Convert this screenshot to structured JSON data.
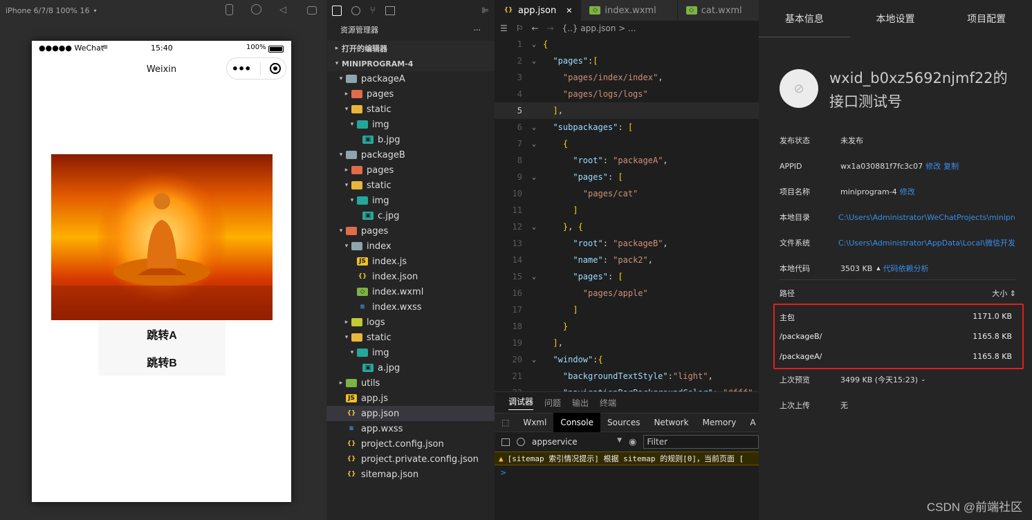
{
  "simulator": {
    "device_label": "iPhone 6/7/8 100% 16",
    "status_carrier": "●●●●● WeChat",
    "status_time": "15:40",
    "status_battery": "100%",
    "nav_title": "Weixin",
    "button_a": "跳转A",
    "button_b": "跳转B"
  },
  "explorer": {
    "title": "资源管理器",
    "more": "···",
    "open_editors": "打开的编辑器",
    "project": "MINIPROGRAM-4",
    "tree": [
      {
        "label": "packageA",
        "depth": 1,
        "arrow": "▾",
        "icon": "folder"
      },
      {
        "label": "pages",
        "depth": 2,
        "arrow": "▸",
        "icon": "pages-folder"
      },
      {
        "label": "static",
        "depth": 2,
        "arrow": "▾",
        "icon": "static-folder"
      },
      {
        "label": "img",
        "depth": 3,
        "arrow": "▾",
        "icon": "img-folder"
      },
      {
        "label": "b.jpg",
        "depth": 4,
        "arrow": "",
        "icon": "image-file"
      },
      {
        "label": "packageB",
        "depth": 1,
        "arrow": "▾",
        "icon": "folder"
      },
      {
        "label": "pages",
        "depth": 2,
        "arrow": "▸",
        "icon": "pages-folder"
      },
      {
        "label": "static",
        "depth": 2,
        "arrow": "▾",
        "icon": "static-folder"
      },
      {
        "label": "img",
        "depth": 3,
        "arrow": "▾",
        "icon": "img-folder"
      },
      {
        "label": "c.jpg",
        "depth": 4,
        "arrow": "",
        "icon": "image-file"
      },
      {
        "label": "pages",
        "depth": 1,
        "arrow": "▾",
        "icon": "pages-folder"
      },
      {
        "label": "index",
        "depth": 2,
        "arrow": "▾",
        "icon": "folder"
      },
      {
        "label": "index.js",
        "depth": 3,
        "arrow": "",
        "icon": "js-file"
      },
      {
        "label": "index.json",
        "depth": 3,
        "arrow": "",
        "icon": "json-file"
      },
      {
        "label": "index.wxml",
        "depth": 3,
        "arrow": "",
        "icon": "wxml-file"
      },
      {
        "label": "index.wxss",
        "depth": 3,
        "arrow": "",
        "icon": "wxss-file"
      },
      {
        "label": "logs",
        "depth": 2,
        "arrow": "▸",
        "icon": "logs-folder"
      },
      {
        "label": "static",
        "depth": 2,
        "arrow": "▾",
        "icon": "static-folder"
      },
      {
        "label": "img",
        "depth": 3,
        "arrow": "▾",
        "icon": "img-folder"
      },
      {
        "label": "a.jpg",
        "depth": 4,
        "arrow": "",
        "icon": "image-file"
      },
      {
        "label": "utils",
        "depth": 1,
        "arrow": "▸",
        "icon": "utils-folder"
      },
      {
        "label": "app.js",
        "depth": 1,
        "arrow": "",
        "icon": "js-file"
      },
      {
        "label": "app.json",
        "depth": 1,
        "arrow": "",
        "icon": "json-file",
        "selected": true
      },
      {
        "label": "app.wxss",
        "depth": 1,
        "arrow": "",
        "icon": "wxss-file"
      },
      {
        "label": "project.config.json",
        "depth": 1,
        "arrow": "",
        "icon": "json-file"
      },
      {
        "label": "project.private.config.json",
        "depth": 1,
        "arrow": "",
        "icon": "json-file"
      },
      {
        "label": "sitemap.json",
        "depth": 1,
        "arrow": "",
        "icon": "json-file"
      }
    ]
  },
  "editor": {
    "tabs": [
      {
        "label": "app.json",
        "icon": "json-file",
        "active": true,
        "close": "✕"
      },
      {
        "label": "index.wxml",
        "icon": "wxml-file"
      },
      {
        "label": "cat.wxml",
        "icon": "wxml-file"
      }
    ],
    "breadcrumb": "{..} app.json > ...",
    "current_line": 5,
    "lines": [
      {
        "n": 1,
        "fold": "v",
        "t": [
          [
            "p",
            "{"
          ]
        ]
      },
      {
        "n": 2,
        "fold": "v",
        "t": [
          [
            "w",
            "  "
          ],
          [
            "k",
            "\"pages\""
          ],
          [
            "w",
            ":"
          ],
          [
            "p",
            "["
          ]
        ]
      },
      {
        "n": 3,
        "fold": "",
        "t": [
          [
            "w",
            "    "
          ],
          [
            "s",
            "\"pages/index/index\""
          ],
          [
            "w",
            ","
          ]
        ]
      },
      {
        "n": 4,
        "fold": "",
        "t": [
          [
            "w",
            "    "
          ],
          [
            "s",
            "\"pages/logs/logs\""
          ]
        ]
      },
      {
        "n": 5,
        "fold": "",
        "t": [
          [
            "w",
            "  "
          ],
          [
            "p",
            "]"
          ],
          [
            "w",
            ","
          ]
        ]
      },
      {
        "n": 6,
        "fold": "v",
        "t": [
          [
            "w",
            "  "
          ],
          [
            "k",
            "\"subpackages\""
          ],
          [
            "w",
            ": "
          ],
          [
            "p",
            "["
          ]
        ]
      },
      {
        "n": 7,
        "fold": "v",
        "t": [
          [
            "w",
            "    "
          ],
          [
            "p",
            "{"
          ]
        ]
      },
      {
        "n": 8,
        "fold": "",
        "t": [
          [
            "w",
            "      "
          ],
          [
            "k",
            "\"root\""
          ],
          [
            "w",
            ": "
          ],
          [
            "s",
            "\"packageA\""
          ],
          [
            "w",
            ","
          ]
        ]
      },
      {
        "n": 9,
        "fold": "v",
        "t": [
          [
            "w",
            "      "
          ],
          [
            "k",
            "\"pages\""
          ],
          [
            "w",
            ": "
          ],
          [
            "p",
            "["
          ]
        ]
      },
      {
        "n": 10,
        "fold": "",
        "t": [
          [
            "w",
            "        "
          ],
          [
            "s",
            "\"pages/cat\""
          ]
        ]
      },
      {
        "n": 11,
        "fold": "",
        "t": [
          [
            "w",
            "      "
          ],
          [
            "p",
            "]"
          ]
        ]
      },
      {
        "n": 12,
        "fold": "v",
        "t": [
          [
            "w",
            "    "
          ],
          [
            "p",
            "}"
          ],
          [
            "w",
            ", "
          ],
          [
            "p",
            "{"
          ]
        ]
      },
      {
        "n": 13,
        "fold": "",
        "t": [
          [
            "w",
            "      "
          ],
          [
            "k",
            "\"root\""
          ],
          [
            "w",
            ": "
          ],
          [
            "s",
            "\"packageB\""
          ],
          [
            "w",
            ","
          ]
        ]
      },
      {
        "n": 14,
        "fold": "",
        "t": [
          [
            "w",
            "      "
          ],
          [
            "k",
            "\"name\""
          ],
          [
            "w",
            ": "
          ],
          [
            "s",
            "\"pack2\""
          ],
          [
            "w",
            ","
          ]
        ]
      },
      {
        "n": 15,
        "fold": "v",
        "t": [
          [
            "w",
            "      "
          ],
          [
            "k",
            "\"pages\""
          ],
          [
            "w",
            ": "
          ],
          [
            "p",
            "["
          ]
        ]
      },
      {
        "n": 16,
        "fold": "",
        "t": [
          [
            "w",
            "        "
          ],
          [
            "s",
            "\"pages/apple\""
          ]
        ]
      },
      {
        "n": 17,
        "fold": "",
        "t": [
          [
            "w",
            "      "
          ],
          [
            "p",
            "]"
          ]
        ]
      },
      {
        "n": 18,
        "fold": "",
        "t": [
          [
            "w",
            "    "
          ],
          [
            "p",
            "}"
          ]
        ]
      },
      {
        "n": 19,
        "fold": "",
        "t": [
          [
            "w",
            "  "
          ],
          [
            "p",
            "]"
          ],
          [
            "w",
            ","
          ]
        ]
      },
      {
        "n": 20,
        "fold": "v",
        "t": [
          [
            "w",
            "  "
          ],
          [
            "k",
            "\"window\""
          ],
          [
            "w",
            ":"
          ],
          [
            "p",
            "{"
          ]
        ]
      },
      {
        "n": 21,
        "fold": "",
        "t": [
          [
            "w",
            "    "
          ],
          [
            "k",
            "\"backgroundTextStyle\""
          ],
          [
            "w",
            ":"
          ],
          [
            "s",
            "\"light\""
          ],
          [
            "w",
            ","
          ]
        ]
      },
      {
        "n": 22,
        "fold": "",
        "t": [
          [
            "w",
            "    "
          ],
          [
            "k",
            "\"navigationBarBackgroundColor\""
          ],
          [
            "w",
            ": "
          ],
          [
            "s",
            "\"#fff\""
          ]
        ]
      }
    ]
  },
  "devtools": {
    "tabs": [
      "调试器",
      "问题",
      "输出",
      "终端"
    ],
    "subtabs": [
      "Wxml",
      "Console",
      "Sources",
      "Network",
      "Memory",
      "A"
    ],
    "context": "appservice",
    "filter_placeholder": "Filter",
    "warning": "[sitemap 索引情况提示] 根据 sitemap 的规则[0]，当前页面 [",
    "prompt": ">"
  },
  "info": {
    "tabs": [
      "基本信息",
      "本地设置",
      "项目配置"
    ],
    "project_name_title": "wxid_b0xz5692njmf22的接口测试号",
    "rows": [
      {
        "label": "发布状态",
        "value": "未发布"
      },
      {
        "label": "APPID",
        "value": "wx1a030881f7fc3c07",
        "links": [
          "修改",
          "复制"
        ]
      },
      {
        "label": "项目名称",
        "value": "miniprogram-4",
        "links": [
          "修改"
        ]
      },
      {
        "label": "本地目录",
        "value": "C:\\Users\\Administrator\\WeChatProjects\\miniprogr...",
        "is_link": true
      },
      {
        "label": "文件系统",
        "value": "C:\\Users\\Administrator\\AppData\\Local\\微信开发...",
        "is_link": true
      },
      {
        "label": "本地代码",
        "value": "3503 KB",
        "links": [
          "代码依赖分析"
        ]
      }
    ],
    "path_header": "路径",
    "size_header": "大小 ⇕",
    "packages": [
      {
        "path": "主包",
        "size": "1171.0 KB"
      },
      {
        "path": "/packageB/",
        "size": "1165.8 KB"
      },
      {
        "path": "/packageA/",
        "size": "1165.8 KB"
      }
    ],
    "last_preview_label": "上次预览",
    "last_preview_value": "3499 KB  (今天15:23)",
    "last_upload_label": "上次上传",
    "last_upload_value": "无"
  },
  "watermark": "CSDN @前端社区"
}
